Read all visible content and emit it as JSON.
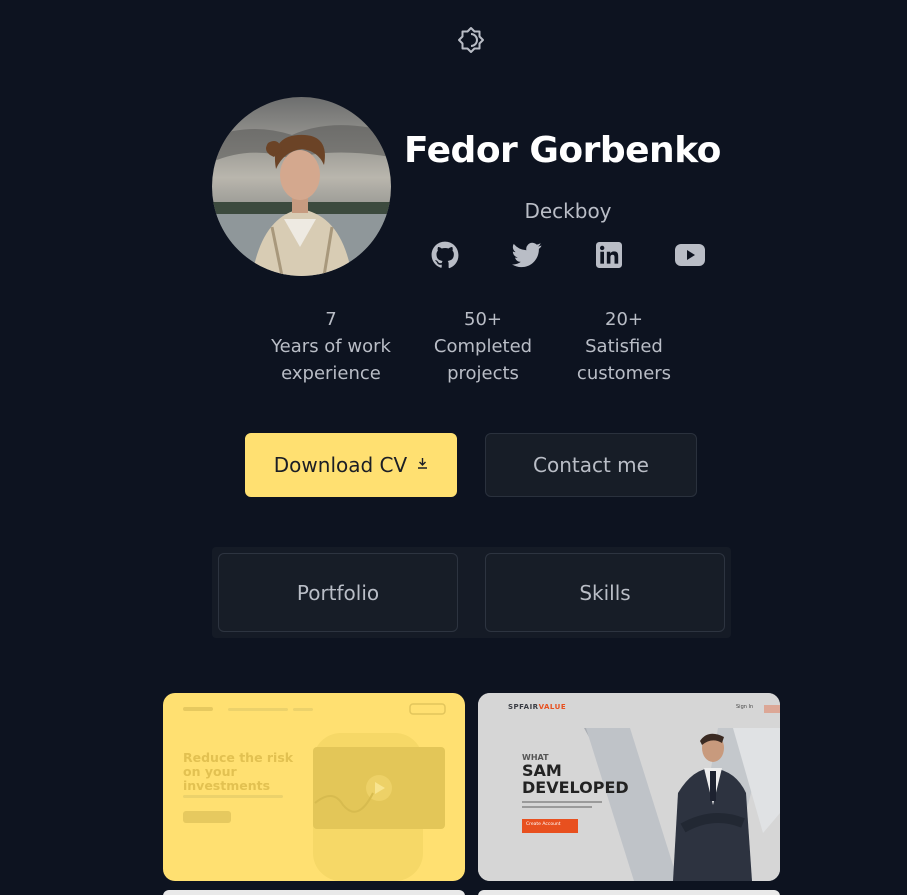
{
  "profile": {
    "name": "Fedor Gorbenko",
    "nickname": "Deckboy"
  },
  "social": [
    {
      "icon": "github-icon"
    },
    {
      "icon": "twitter-icon"
    },
    {
      "icon": "linkedin-icon"
    },
    {
      "icon": "youtube-icon"
    }
  ],
  "stats": [
    {
      "value": "7",
      "line1": "Years of work",
      "line2": "experience"
    },
    {
      "value": "50+",
      "line1": "Completed",
      "line2": "projects"
    },
    {
      "value": "20+",
      "line1": "Satisfied",
      "line2": "customers"
    }
  ],
  "buttons": {
    "download_cv": "Download CV",
    "contact": "Contact me"
  },
  "tabs": [
    "Portfolio",
    "Skills"
  ],
  "cards": [
    {
      "headline1": "Reduce the risk",
      "headline2": "on your",
      "headline3": "investments"
    },
    {
      "brand_a": "SPFAIR",
      "brand_b": "VALUE",
      "nav_signin": "Sign In",
      "what": "WHAT",
      "sam": "SAM",
      "developed": "DEVELOPED",
      "cta": "Create Account"
    }
  ],
  "colors": {
    "background": "#0d1320",
    "accent": "#ffe071",
    "button_dark": "#171d27",
    "text_muted": "#b9bdc6",
    "cta_orange": "#e8501f"
  }
}
